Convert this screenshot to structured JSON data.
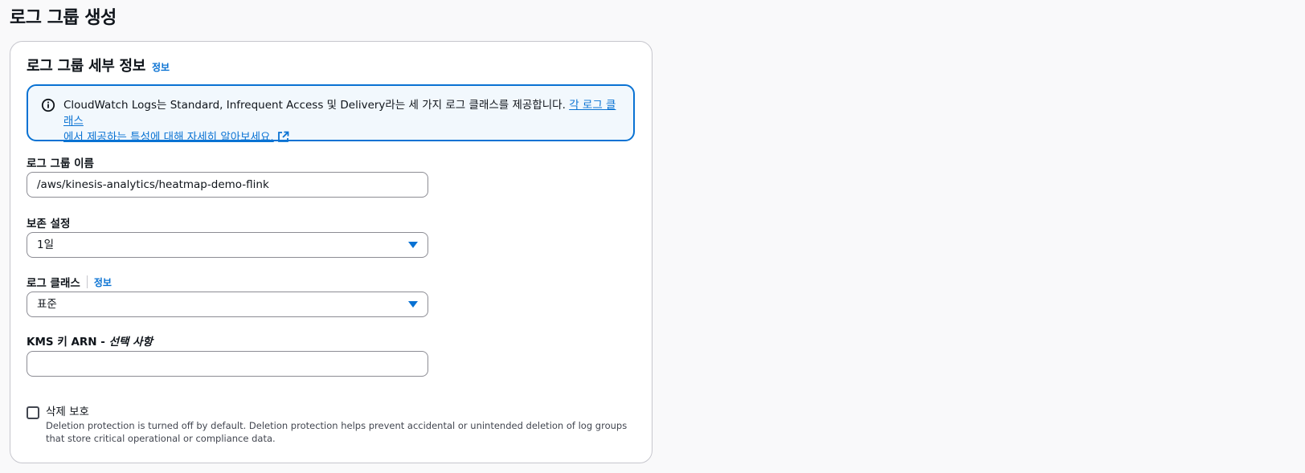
{
  "page": {
    "title": "로그 그룹 생성"
  },
  "panel": {
    "title": "로그 그룹 세부 정보",
    "info_link": "정보"
  },
  "alert": {
    "text": "CloudWatch Logs는 Standard, Infrequent Access 및 Delivery라는 세 가지 로그 클래스를 제공합니다. ",
    "link_line1": "각 로그 클래스",
    "link_line2": "에서 제공하는 특성에 대해 자세히 알아보세요.",
    "icon": "info-icon",
    "link_icon": "external-link-icon"
  },
  "fields": {
    "log_group_name": {
      "label": "로그 그룹 이름",
      "value": "/aws/kinesis-analytics/heatmap-demo-flink"
    },
    "retention": {
      "label": "보존 설정",
      "value": "1일"
    },
    "log_class": {
      "label": "로그 클래스",
      "info_link": "정보",
      "value": "표준"
    },
    "kms": {
      "label": "KMS 키 ARN - ",
      "optional": "선택 사항",
      "value": ""
    }
  },
  "deletion_protection": {
    "label": "삭제 보호",
    "checked": false,
    "description": "Deletion protection is turned off by default. Deletion protection helps prevent accidental or unintended deletion of log groups that store critical operational or compliance data."
  },
  "colors": {
    "accent": "#0972d3",
    "alert_bg": "#f2f8fd",
    "border": "#8c8c94"
  }
}
